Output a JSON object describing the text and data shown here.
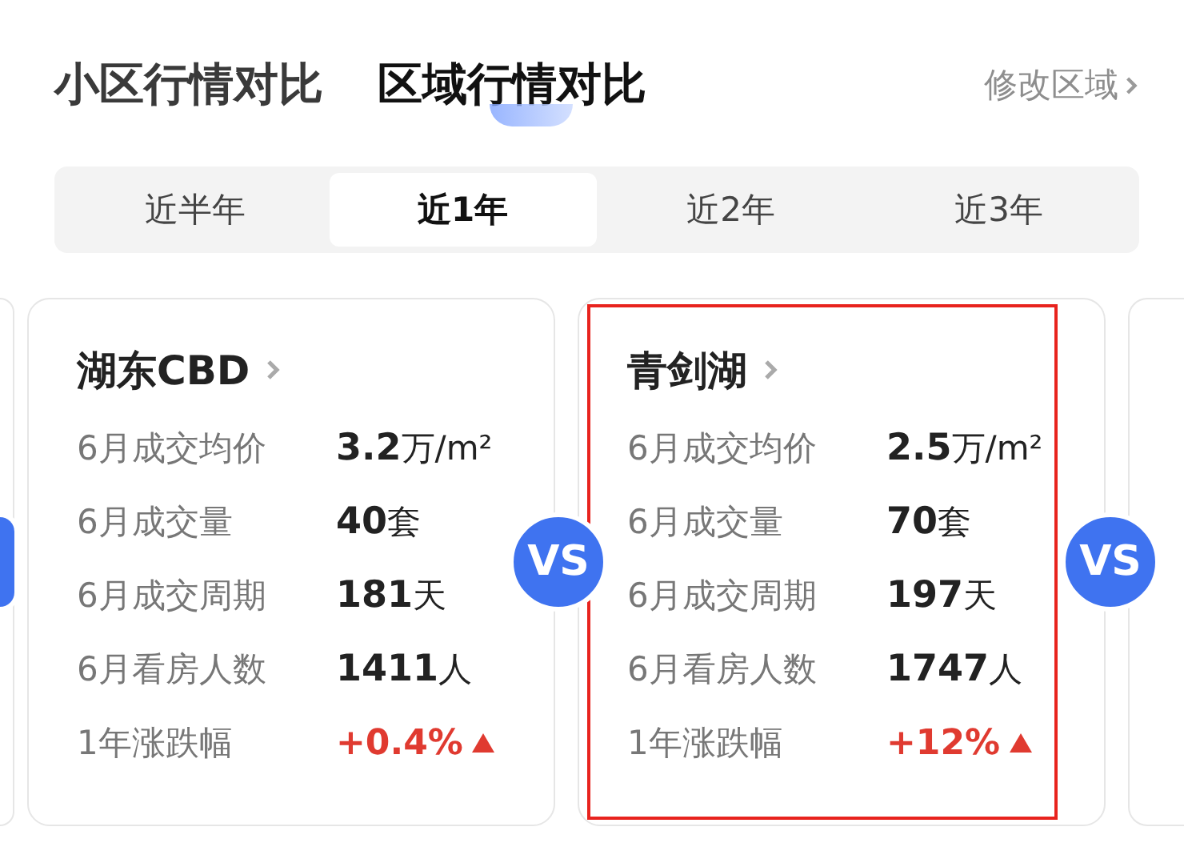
{
  "header_tabs": [
    {
      "label": "小区行情对比",
      "selected": false
    },
    {
      "label": "区域行情对比",
      "selected": true
    }
  ],
  "edit_link": "修改区域",
  "period_tabs": [
    {
      "label": "近半年",
      "selected": false
    },
    {
      "label": "近1年",
      "selected": true
    },
    {
      "label": "近2年",
      "selected": false
    },
    {
      "label": "近3年",
      "selected": false
    }
  ],
  "vs_badges": [
    "VS",
    "VS"
  ],
  "cards": [
    {
      "title": "湖东CBD",
      "highlighted": false,
      "rows": [
        {
          "label": "6月成交均价",
          "value": "3.2",
          "unit": "万/m²",
          "kind": "plain"
        },
        {
          "label": "6月成交量",
          "value": "40",
          "unit": "套",
          "kind": "plain"
        },
        {
          "label": "6月成交周期",
          "value": "181",
          "unit": "天",
          "kind": "plain"
        },
        {
          "label": "6月看房人数",
          "value": "1411",
          "unit": "人",
          "kind": "plain"
        },
        {
          "label": "1年涨跌幅",
          "value": "+0.4%",
          "kind": "up"
        }
      ]
    },
    {
      "title": "青剑湖",
      "highlighted": true,
      "rows": [
        {
          "label": "6月成交均价",
          "value": "2.5",
          "unit": "万/m²",
          "kind": "plain"
        },
        {
          "label": "6月成交量",
          "value": "70",
          "unit": "套",
          "kind": "plain"
        },
        {
          "label": "6月成交周期",
          "value": "197",
          "unit": "天",
          "kind": "plain"
        },
        {
          "label": "6月看房人数",
          "value": "1747",
          "unit": "人",
          "kind": "plain"
        },
        {
          "label": "1年涨跌幅",
          "value": "+12%",
          "kind": "up"
        }
      ]
    }
  ]
}
